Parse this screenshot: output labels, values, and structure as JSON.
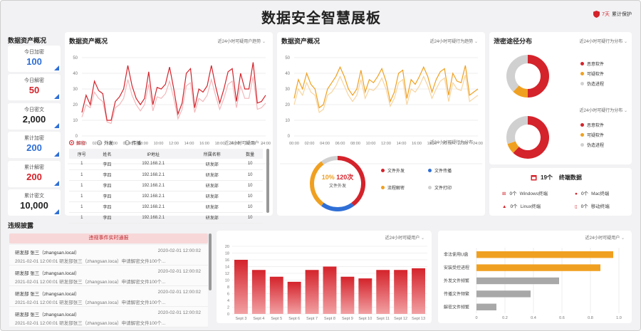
{
  "header": {
    "title": "数据安全智慧展板",
    "protection_days": "7天",
    "protection_label": "累计保护"
  },
  "colors": {
    "red": "#d4232b",
    "orange": "#f0a020",
    "blue": "#2f6fd6",
    "gray": "#c8c8c8"
  },
  "assets": {
    "section_title": "数据资产概况",
    "stats": [
      {
        "label": "今日加密",
        "value": "100",
        "color": "#2f6fd6"
      },
      {
        "label": "今日解密",
        "value": "50",
        "color": "#d4232b"
      },
      {
        "label": "今日密文",
        "value": "2,000",
        "color": "#222222"
      },
      {
        "label": "累计加密",
        "value": "200",
        "color": "#2f6fd6"
      },
      {
        "label": "累计解密",
        "value": "200",
        "color": "#d4232b"
      },
      {
        "label": "累计密文",
        "value": "10,000",
        "color": "#222222"
      }
    ]
  },
  "panel1": {
    "title": "数据资产概况",
    "dropdown": "近24小时可疑用户趋势",
    "chart_data": {
      "type": "line",
      "x": [
        "00:00",
        "02:00",
        "04:00",
        "06:00",
        "08:00",
        "10:00",
        "12:00",
        "14:00",
        "16:00",
        "18:00",
        "20:00",
        "22:00",
        "24:00"
      ],
      "ylim": [
        0,
        50
      ],
      "yticks": [
        "0",
        "10",
        "20",
        "30",
        "40",
        "50"
      ],
      "series": [
        {
          "color": "#d4232b",
          "values": [
            15,
            26,
            20,
            35,
            29,
            27,
            10,
            10,
            22,
            25,
            30,
            45,
            32,
            24,
            20,
            24,
            41,
            20,
            31,
            30,
            33,
            44,
            30,
            14,
            21,
            40,
            43,
            18,
            30,
            28,
            32,
            45,
            32,
            21,
            30,
            41,
            43,
            22,
            40,
            30,
            30,
            47,
            21,
            22,
            26
          ]
        },
        {
          "color": "#f3b9bc",
          "values": [
            12,
            20,
            18,
            28,
            24,
            22,
            9,
            8,
            18,
            20,
            24,
            36,
            26,
            20,
            16,
            20,
            33,
            16,
            25,
            24,
            27,
            35,
            24,
            11,
            17,
            32,
            34,
            15,
            24,
            22,
            26,
            36,
            26,
            17,
            24,
            33,
            35,
            18,
            32,
            24,
            24,
            38,
            17,
            18,
            21
          ]
        }
      ]
    },
    "filters": [
      {
        "label": "解密",
        "selected": true
      },
      {
        "label": "外发",
        "selected": false
      },
      {
        "label": "传播",
        "selected": false
      }
    ],
    "filter_dropdown": "近24小时可疑用户",
    "table": {
      "headers": [
        "序号",
        "姓名",
        "IP地址",
        "所属名称",
        "数量"
      ],
      "rows": [
        [
          "1",
          "李四",
          "192.168.2.1",
          "研发部",
          "10"
        ],
        [
          "1",
          "李四",
          "192.168.2.1",
          "研发部",
          "10"
        ],
        [
          "1",
          "李四",
          "192.168.2.1",
          "研发部",
          "10"
        ],
        [
          "1",
          "李四",
          "192.168.2.1",
          "研发部",
          "10"
        ],
        [
          "1",
          "李四",
          "192.168.2.1",
          "研发部",
          "10"
        ],
        [
          "1",
          "李四",
          "192.168.2.1",
          "研发部",
          "10"
        ]
      ]
    }
  },
  "panel2": {
    "title": "数据资产概况",
    "dropdown": "近24小时可疑行为趋势",
    "chart_data": {
      "type": "line",
      "x": [
        "00:00",
        "02:00",
        "04:00",
        "06:00",
        "08:00",
        "10:00",
        "12:00",
        "14:00",
        "16:00",
        "18:00",
        "20:00",
        "22:00",
        "24:00"
      ],
      "ylim": [
        0,
        50
      ],
      "yticks": [
        "0",
        "10",
        "20",
        "30",
        "40",
        "50"
      ],
      "series": [
        {
          "color": "#f0a020",
          "values": [
            24,
            36,
            30,
            40,
            33,
            30,
            18,
            20,
            30,
            34,
            38,
            44,
            38,
            30,
            26,
            30,
            42,
            28,
            36,
            34,
            38,
            43,
            35,
            22,
            28,
            40,
            42,
            24,
            36,
            33,
            38,
            44,
            38,
            28,
            36,
            41,
            43,
            26,
            40,
            35,
            34,
            45,
            26,
            28,
            30
          ]
        },
        {
          "color": "#f7d5a0",
          "values": [
            20,
            30,
            26,
            34,
            28,
            26,
            15,
            17,
            26,
            28,
            32,
            38,
            32,
            26,
            22,
            26,
            36,
            24,
            30,
            29,
            32,
            37,
            30,
            19,
            24,
            34,
            36,
            20,
            30,
            28,
            32,
            38,
            32,
            24,
            30,
            35,
            37,
            22,
            34,
            30,
            29,
            39,
            22,
            24,
            26
          ]
        }
      ]
    },
    "donut_dropdown": "近24小时可疑行为分布",
    "donut": {
      "percent": "10%",
      "count": "120次",
      "label": "文件外发",
      "chart_data": {
        "type": "pie",
        "slices": [
          {
            "name": "文件外发",
            "value": 40,
            "color": "#d4232b"
          },
          {
            "name": "文件传播",
            "value": 20,
            "color": "#2f6fd6"
          },
          {
            "name": "流程解密",
            "value": 30,
            "color": "#f0a020"
          },
          {
            "name": "文件打印",
            "value": 10,
            "color": "#d0d0d0"
          }
        ]
      }
    },
    "legend": [
      {
        "name": "文件外发",
        "color": "#d4232b"
      },
      {
        "name": "文件传播",
        "color": "#2f6fd6"
      },
      {
        "name": "流程解密",
        "color": "#f0a020"
      },
      {
        "name": "文件打印",
        "color": "#d0d0d0"
      }
    ]
  },
  "leak": {
    "title": "泄密途径分布",
    "donut1": {
      "dropdown": "近24小时可疑行为分布",
      "chart_data": {
        "type": "pie",
        "slices": [
          {
            "name": "恶意软件",
            "value": 50,
            "color": "#d4232b"
          },
          {
            "name": "可疑软件",
            "value": 12,
            "color": "#f0a020"
          },
          {
            "name": "伪造进程",
            "value": 38,
            "color": "#d0d0d0"
          }
        ]
      }
    },
    "donut2": {
      "dropdown": "近24小时可疑行为分布",
      "chart_data": {
        "type": "pie",
        "slices": [
          {
            "name": "恶意软件",
            "value": 62,
            "color": "#d4232b"
          },
          {
            "name": "可疑软件",
            "value": 8,
            "color": "#f0a020"
          },
          {
            "name": "伪造进程",
            "value": 30,
            "color": "#d0d0d0"
          }
        ]
      }
    },
    "legend": [
      {
        "name": "恶意软件",
        "color": "#d4232b"
      },
      {
        "name": "可疑软件",
        "color": "#f0a020"
      },
      {
        "name": "伪造进程",
        "color": "#d0d0d0"
      }
    ]
  },
  "terminal": {
    "count": "19个",
    "label": "终端数据",
    "items": [
      {
        "count": "0个",
        "label": "Windows终端"
      },
      {
        "count": "0个",
        "label": "Mac终端"
      },
      {
        "count": "0个",
        "label": "Linux终端"
      },
      {
        "count": "0个",
        "label": "移动终端"
      }
    ]
  },
  "violation": {
    "section_title": "违规披露",
    "alert_header": "违规事件实时通报",
    "alerts": [
      {
        "user": "研发部 张三（zhangsan.local）",
        "time": "2020-02-01 12:00:02",
        "desc": "2021-02-01 12:00:01 研发部张三（zhangsan.loca）申请解密文件100个..."
      },
      {
        "user": "研发部 张三（zhangsan.local）",
        "time": "2020-02-01 12:00:02",
        "desc": "2021-02-01 12:00:01 研发部张三（zhangsan.loca）申请解密文件100个..."
      },
      {
        "user": "研发部 张三（zhangsan.local）",
        "time": "2020-02-01 12:00:02",
        "desc": "2021-02-01 12:00:01 研发部张三（zhangsan.loca）申请解密文件100个..."
      },
      {
        "user": "研发部 张三（zhangsan.local）",
        "time": "2020-02-01 12:00:02",
        "desc": "2021-02-01 12:00:01 研发部张三（zhangsan.loca）申请解密文件100个..."
      }
    ]
  },
  "bar_panel": {
    "dropdown": "近24小时可疑用户",
    "chart_data": {
      "type": "bar",
      "categories": [
        "Sept 3",
        "Sept 4",
        "Sept 5",
        "Sept 6",
        "Sept 7",
        "Sept 8",
        "Sept 9",
        "Sept 10",
        "Sept 11",
        "Sept 12",
        "Sept 13"
      ],
      "values": [
        16,
        13,
        11,
        9.5,
        13,
        14,
        11,
        10.5,
        13,
        13,
        13.5
      ],
      "ylim": [
        0,
        20
      ],
      "yticks": [
        "0",
        "2",
        "4",
        "6",
        "8",
        "10",
        "12",
        "14",
        "16",
        "18",
        "20"
      ]
    }
  },
  "hbar_panel": {
    "dropdown": "近24小时可疑用户",
    "chart_data": {
      "type": "bar",
      "orientation": "horizontal",
      "categories": [
        "非法使用U盘",
        "安装受控进程",
        "外发文件频繁",
        "传播文件频繁",
        "解密文件频繁"
      ],
      "values": [
        0.96,
        0.87,
        0.58,
        0.38,
        0.14
      ],
      "colors": [
        "#f0a020",
        "#f0a020",
        "#a8a8a8",
        "#a8a8a8",
        "#a8a8a8"
      ],
      "xlim": [
        0,
        1
      ],
      "xticks": [
        "0",
        "0.2",
        "0.4",
        "0.6",
        "0.8",
        "1.0"
      ]
    }
  }
}
